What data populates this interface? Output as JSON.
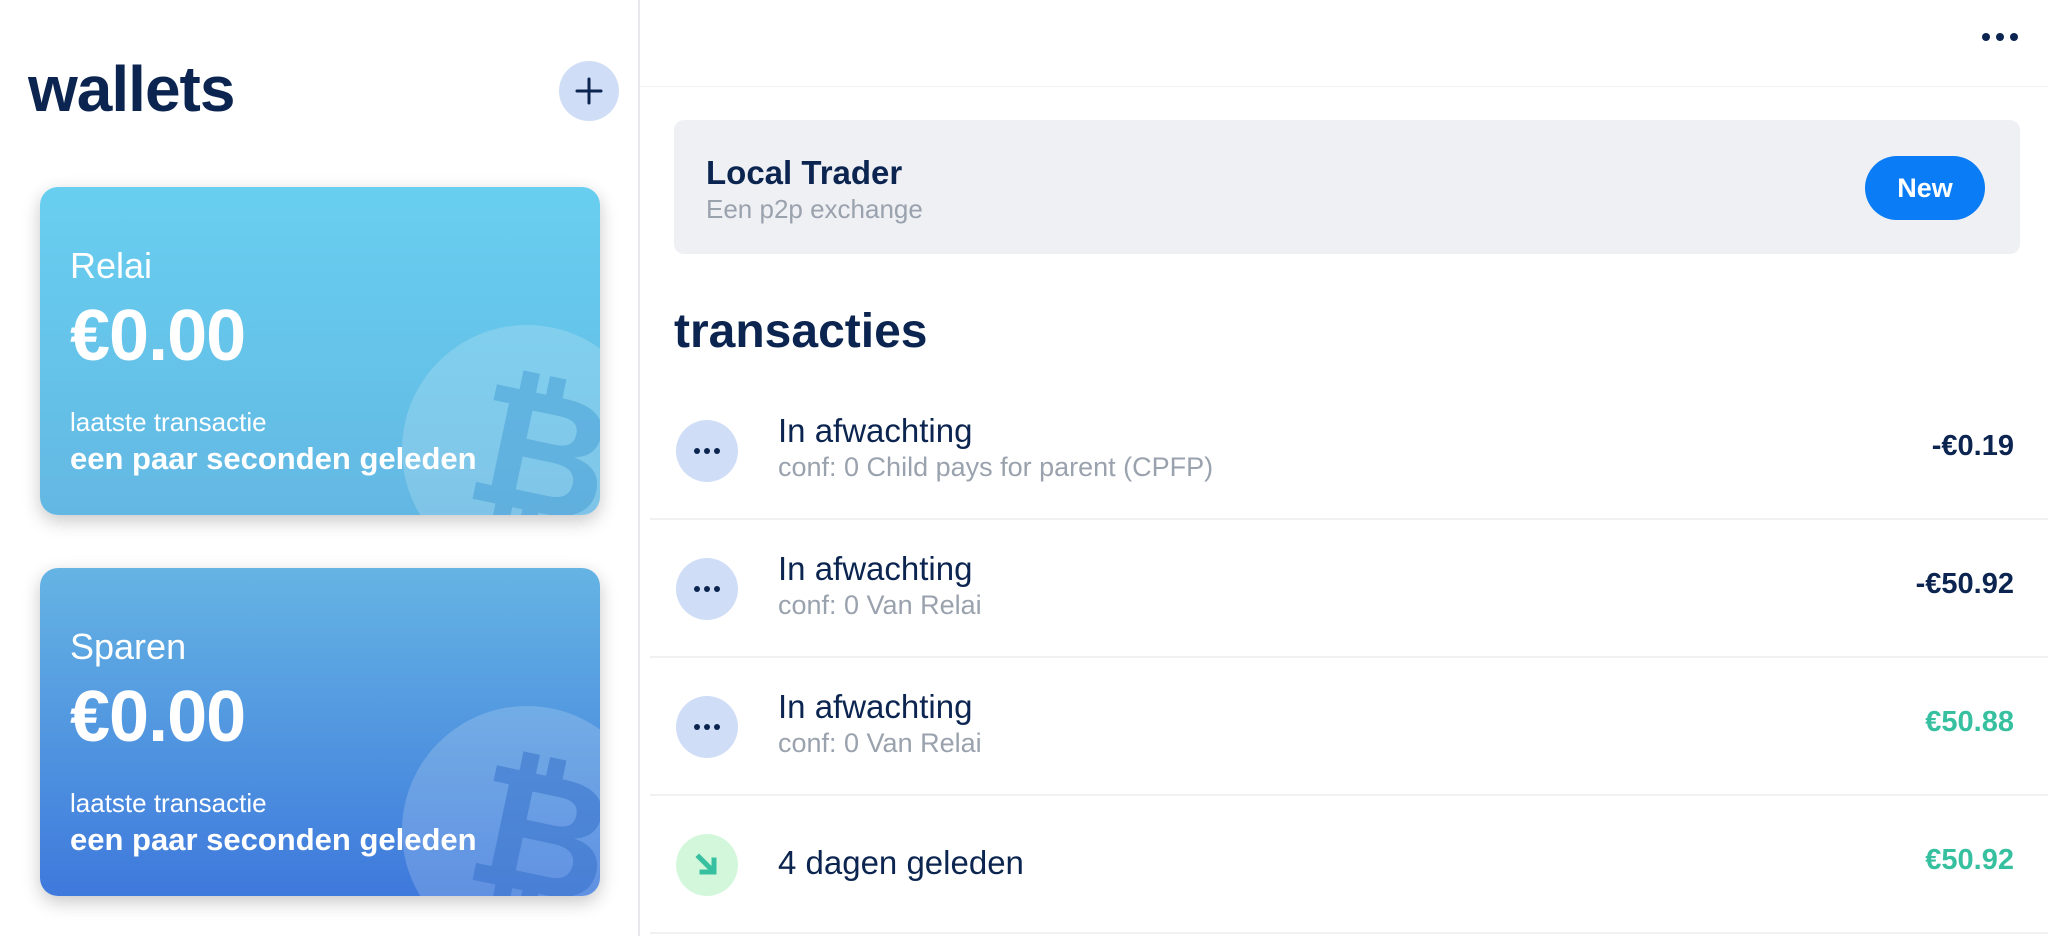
{
  "sidebar": {
    "title": "wallets",
    "add_icon": "plus-icon",
    "wallets": [
      {
        "name": "Relai",
        "balance": "€0.00",
        "last_tx_label": "laatste transactie",
        "last_tx_time": "een paar seconden geleden",
        "gradient": [
          "#68cff0",
          "#63b8e3"
        ],
        "watermark_icon": "bitcoin-icon"
      },
      {
        "name": "Sparen",
        "balance": "€0.00",
        "last_tx_label": "laatste transactie",
        "last_tx_time": "een paar seconden geleden",
        "gradient": [
          "#65b4e4",
          "#3e79dc"
        ],
        "watermark_icon": "bitcoin-icon"
      }
    ]
  },
  "header": {
    "more_icon": "more-horizontal-icon"
  },
  "promo": {
    "title": "Local Trader",
    "subtitle": "Een p2p exchange",
    "button_label": "New",
    "button_color": "#0a7cf5"
  },
  "transactions": {
    "title": "transacties",
    "items": [
      {
        "title": "In afwachting",
        "subtitle": "conf: 0 Child pays for parent (CPFP)",
        "amount": "-€0.19",
        "direction": "out",
        "icon": "pending-dots-icon"
      },
      {
        "title": "In afwachting",
        "subtitle": "conf: 0 Van Relai",
        "amount": "-€50.92",
        "direction": "out",
        "icon": "pending-dots-icon"
      },
      {
        "title": "In afwachting",
        "subtitle": "conf: 0 Van Relai",
        "amount": "€50.88",
        "direction": "in",
        "icon": "pending-dots-icon"
      },
      {
        "title": "4 dagen geleden",
        "subtitle": "",
        "amount": "€50.92",
        "direction": "in",
        "icon": "incoming-arrow-icon"
      }
    ]
  },
  "colors": {
    "text_primary": "#0c2550",
    "text_secondary": "#9aa2ae",
    "amount_positive": "#37c0a0",
    "accent": "#0a7cf5"
  }
}
